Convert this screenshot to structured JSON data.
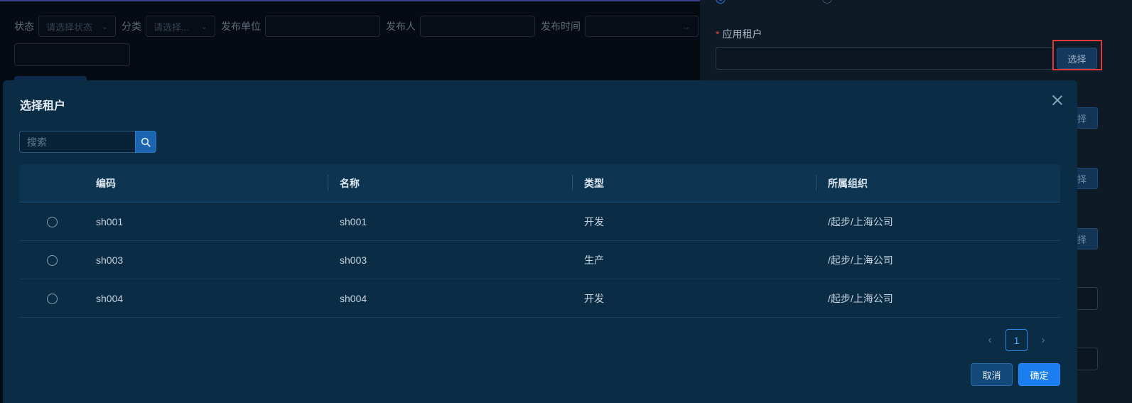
{
  "background_page": {
    "filters": [
      {
        "label": "状态",
        "placeholder": "请选择状态",
        "type": "select"
      },
      {
        "label": "分类",
        "placeholder": "请选择...",
        "type": "select"
      },
      {
        "label": "发布单位",
        "placeholder": "",
        "type": "input"
      },
      {
        "label": "发布人",
        "placeholder": "",
        "type": "input"
      },
      {
        "label": "发布时间",
        "placeholder": "→",
        "type": "range"
      }
    ]
  },
  "drawer": {
    "field_label": "应用租户",
    "required_mark": "*",
    "select_button": "选择",
    "other_select_buttons": [
      "择",
      "择",
      "择"
    ]
  },
  "modal": {
    "title": "选择租户",
    "search": {
      "placeholder": "搜索"
    },
    "columns": [
      "编码",
      "名称",
      "类型",
      "所属组织"
    ],
    "rows": [
      {
        "code": "sh001",
        "name": "sh001",
        "type": "开发",
        "org": "/起步/上海公司"
      },
      {
        "code": "sh003",
        "name": "sh003",
        "type": "生产",
        "org": "/起步/上海公司"
      },
      {
        "code": "sh004",
        "name": "sh004",
        "type": "开发",
        "org": "/起步/上海公司"
      }
    ],
    "pagination": {
      "prev": "‹",
      "current_page": "1",
      "next": "›"
    },
    "cancel_label": "取消",
    "ok_label": "确定"
  },
  "colors": {
    "accent": "#1b7ef0",
    "modal_bg": "#0a2c45",
    "highlight": "#e4393c"
  }
}
